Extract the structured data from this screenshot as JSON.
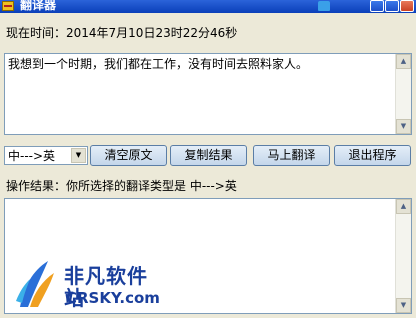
{
  "window": {
    "title": "翻译器"
  },
  "header": {
    "time_label": "现在时间：2014年7月10日23时22分46秒"
  },
  "source": {
    "text": "我想到一个时期，我们都在工作，没有时间去照料家人。"
  },
  "toolbar": {
    "mode_selected": "中--->英",
    "clear_label": "清空原文",
    "copy_label": "复制结果",
    "translate_label": "马上翻译",
    "exit_label": "退出程序"
  },
  "result": {
    "label": "操作结果：你所选择的翻译类型是   中--->英",
    "text": ""
  },
  "watermark": {
    "cn": "非凡软件站",
    "en": "CRSKY.com"
  },
  "icons": {
    "app": "app-icon",
    "skin": "shirt-icon",
    "minimize": "minimize-icon",
    "maximize": "maximize-icon",
    "close": "close-icon",
    "scroll_up": "arrow-up-icon",
    "scroll_down": "arrow-down-icon",
    "dropdown": "chevron-down-icon"
  }
}
